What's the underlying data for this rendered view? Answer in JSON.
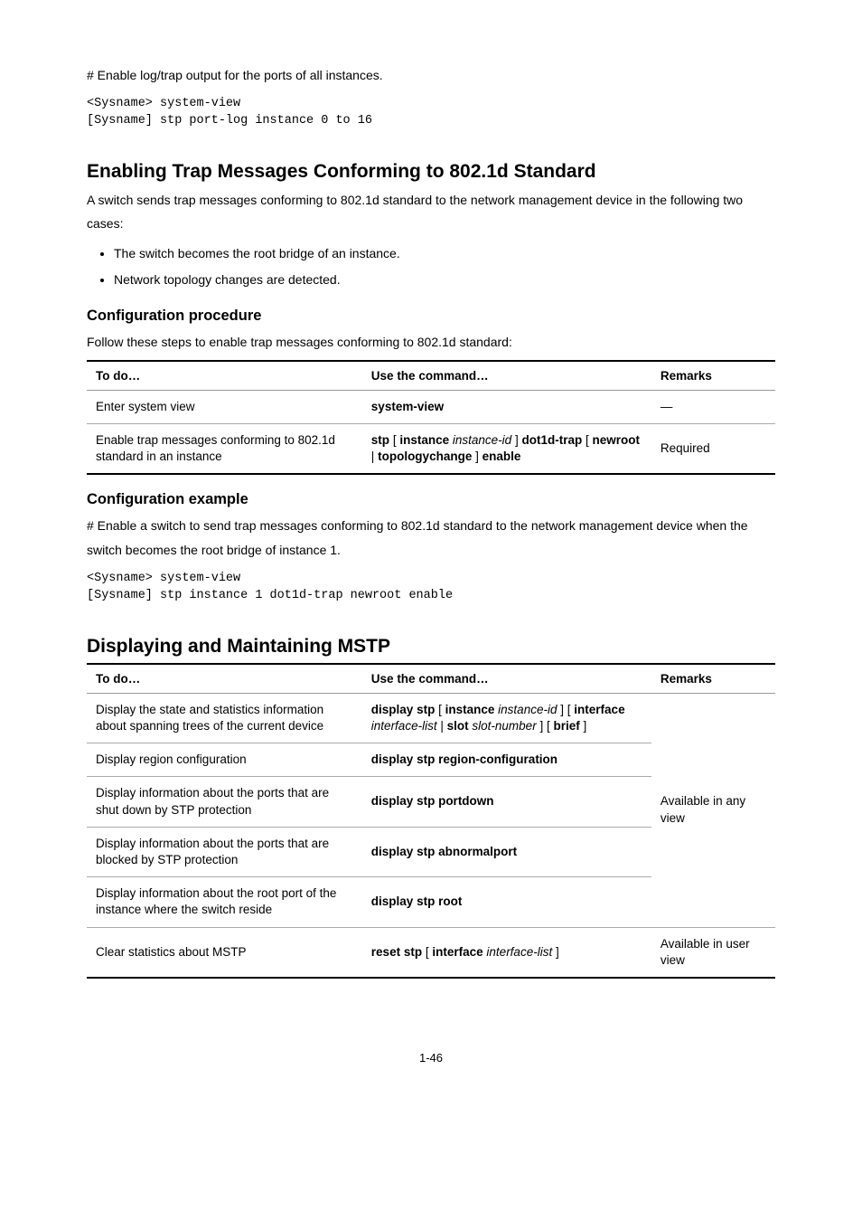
{
  "intro_text": "# Enable log/trap output for the ports of all instances.",
  "code1_line1": "<Sysname> system-view",
  "code1_line2": "[Sysname] stp port-log instance 0 to 16",
  "section1": {
    "h2": "Enabling Trap Messages Conforming to 802.1d Standard",
    "para": "A switch sends trap messages conforming to 802.1d standard to the network management device in the following two cases:",
    "bullet1": "The switch becomes the root bridge of an instance.",
    "bullet2": "Network topology changes are detected.",
    "h3_proc": "Configuration procedure",
    "steps_intro": "Follow these steps to enable trap messages conforming to 802.1d standard:",
    "table": {
      "h1": "To do…",
      "h2": "Use the command…",
      "h3": "Remarks",
      "r1c1": "Enter system view",
      "r1c2": "system-view",
      "r1c3": "—",
      "r2c1": "Enable trap messages conforming to 802.1d standard in an instance",
      "r2c2_a": "stp",
      "r2c2_b": "[",
      "r2c2_c": "instance",
      "r2c2_d": "instance-id",
      "r2c2_e": "]",
      "r2c2_f": "dot1d-trap",
      "r2c2_g": "[",
      "r2c2_h": "newroot",
      "r2c2_i": "|",
      "r2c2_j": "topologychange",
      "r2c2_k": "]",
      "r2c2_l": "enable",
      "r2c3": "Required"
    },
    "h3_ex": "Configuration example",
    "ex_para": "# Enable a switch to send trap messages conforming to 802.1d standard to the network management device when the switch becomes the root bridge of instance 1.",
    "code2_line1": "<Sysname> system-view",
    "code2_line2": "[Sysname] stp instance 1 dot1d-trap newroot enable"
  },
  "section2": {
    "h2": "Displaying and Maintaining MSTP",
    "table": {
      "h1": "To do…",
      "h2": "Use the command…",
      "h3": "Remarks",
      "r1c1": "Display the state and statistics information about spanning trees of the current device",
      "r1c2_a": "display stp",
      "r1c2_b": "[",
      "r1c2_c": "instance",
      "r1c2_d": "instance-id",
      "r1c2_e": "]",
      "r1c2_f": "[",
      "r1c2_g": "interface",
      "r1c2_h": "interface-list",
      "r1c2_i": "|",
      "r1c2_j": "slot",
      "r1c2_k": "slot-number",
      "r1c2_l": "] [",
      "r1c2_m": "brief",
      "r1c2_n": "]",
      "r2c1": "Display region configuration",
      "r2c2": "display stp region-configuration",
      "r3c1": "Display information about the ports that are shut down by STP protection",
      "r3c2": "display stp portdown",
      "r4c1": "Display information about the ports that are blocked by STP protection",
      "r4c2": "display stp abnormalport",
      "r5c1": "Display information about the root port of the instance where the switch reside",
      "r5c2": "display stp root",
      "c3_span": "Available in any view",
      "r6c1": "Clear statistics about MSTP",
      "r6c2_a": "reset stp",
      "r6c2_b": "[",
      "r6c2_c": "interface",
      "r6c2_d": "interface-list",
      "r6c2_e": "]",
      "r6c3": "Available in user view"
    }
  },
  "page_number": "1-46"
}
